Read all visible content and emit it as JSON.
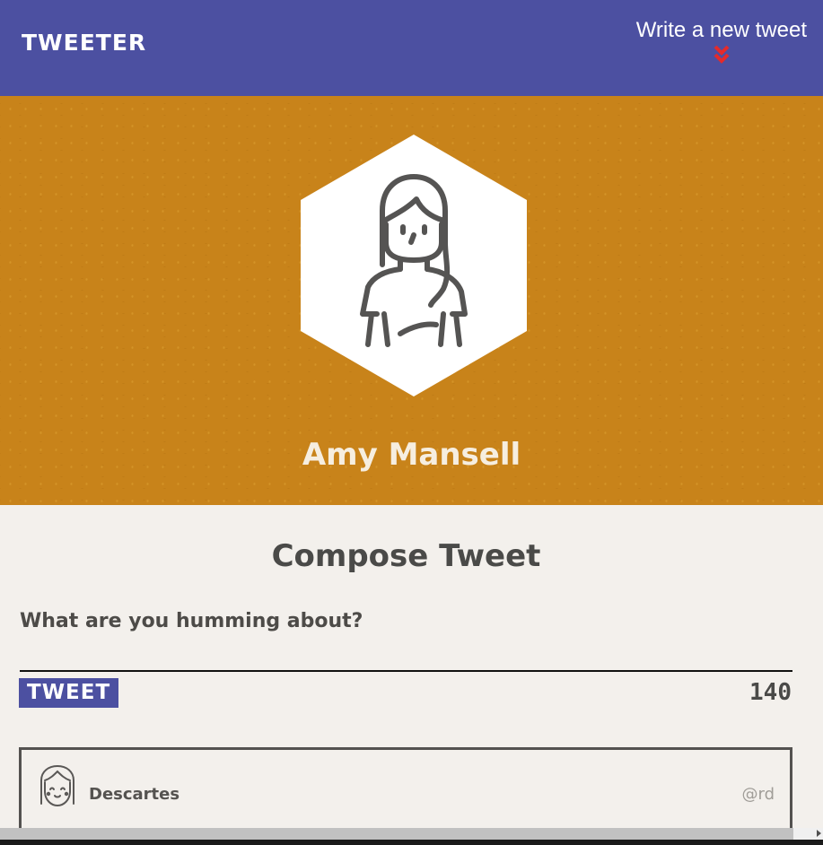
{
  "navbar": {
    "brand": "TWEETER",
    "write_link": "Write a new tweet",
    "chevron_icon": "double-chevron-down-icon",
    "chevron_color": "#e52a2a",
    "background": "#4c50a1"
  },
  "profile": {
    "avatar_icon": "woman-avatar-icon",
    "name": "Amy Mansell",
    "background": "#c8831a"
  },
  "compose": {
    "title": "Compose Tweet",
    "prompt": "What are you humming about?",
    "textarea_value": "",
    "button_label": "TWEET",
    "char_count": "140"
  },
  "tweets": [
    {
      "avatar_icon": "girl-avatar-icon",
      "name": "Descartes",
      "handle": "@rd"
    }
  ]
}
